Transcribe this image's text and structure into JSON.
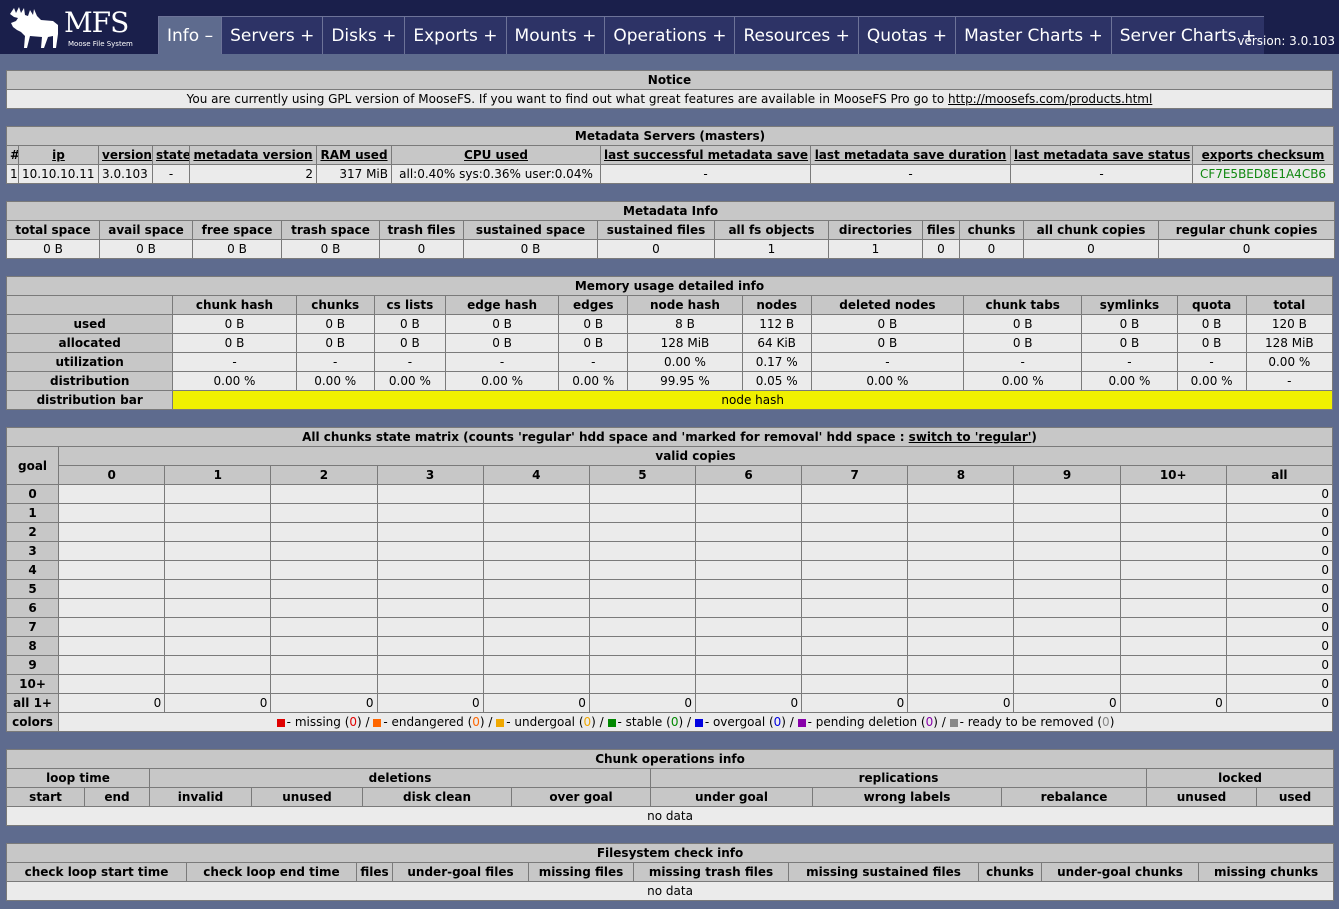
{
  "header": {
    "logo_text": "MFS",
    "logo_sub": "Moose File System",
    "tabs": [
      {
        "label": "Info –",
        "active": true
      },
      {
        "label": "Servers +"
      },
      {
        "label": "Disks +"
      },
      {
        "label": "Exports +"
      },
      {
        "label": "Mounts +"
      },
      {
        "label": "Operations +"
      },
      {
        "label": "Resources +"
      },
      {
        "label": "Quotas +"
      },
      {
        "label": "Master Charts +"
      },
      {
        "label": "Server Charts +"
      }
    ],
    "version": "version: 3.0.103"
  },
  "notice": {
    "title": "Notice",
    "text": "You are currently using GPL version of MooseFS. If you want to find out what great features are available in MooseFS Pro go to ",
    "link": "http://moosefs.com/products.html"
  },
  "masters": {
    "title": "Metadata Servers (masters)",
    "cols": [
      "#",
      "ip",
      "version",
      "state",
      "metadata version",
      "RAM used",
      "CPU used",
      "last successful metadata save",
      "last metadata save duration",
      "last metadata save status",
      "exports checksum"
    ],
    "row": [
      "1",
      "10.10.10.11",
      "3.0.103",
      "-",
      "2",
      "317 MiB",
      "all:0.40% sys:0.36% user:0.04%",
      "-",
      "-",
      "-",
      "CF7E5BED8E1A4CB6"
    ]
  },
  "metainfo": {
    "title": "Metadata Info",
    "cols": [
      "total space",
      "avail space",
      "free space",
      "trash space",
      "trash files",
      "sustained space",
      "sustained files",
      "all fs objects",
      "directories",
      "files",
      "chunks",
      "all chunk copies",
      "regular chunk copies"
    ],
    "row": [
      "0 B",
      "0 B",
      "0 B",
      "0 B",
      "0",
      "0 B",
      "0",
      "1",
      "1",
      "0",
      "0",
      "0",
      "0"
    ]
  },
  "memory": {
    "title": "Memory usage detailed info",
    "cols": [
      "chunk hash",
      "chunks",
      "cs lists",
      "edge hash",
      "edges",
      "node hash",
      "nodes",
      "deleted nodes",
      "chunk tabs",
      "symlinks",
      "quota",
      "total"
    ],
    "rows": [
      {
        "label": "used",
        "values": [
          "0 B",
          "0 B",
          "0 B",
          "0 B",
          "0 B",
          "8 B",
          "112 B",
          "0 B",
          "0 B",
          "0 B",
          "0 B",
          "120 B"
        ]
      },
      {
        "label": "allocated",
        "values": [
          "0 B",
          "0 B",
          "0 B",
          "0 B",
          "0 B",
          "128 MiB",
          "64 KiB",
          "0 B",
          "0 B",
          "0 B",
          "0 B",
          "128 MiB"
        ]
      },
      {
        "label": "utilization",
        "values": [
          "-",
          "-",
          "-",
          "-",
          "-",
          "0.00 %",
          "0.17 %",
          "-",
          "-",
          "-",
          "-",
          "0.00 %"
        ]
      },
      {
        "label": "distribution",
        "values": [
          "0.00 %",
          "0.00 %",
          "0.00 %",
          "0.00 %",
          "0.00 %",
          "99.95 %",
          "0.05 %",
          "0.00 %",
          "0.00 %",
          "0.00 %",
          "0.00 %",
          "-"
        ]
      }
    ],
    "bar_label": "distribution bar",
    "bar_text": "node hash",
    "bar_color": "#f0f000"
  },
  "matrix": {
    "title_pre": "All chunks state matrix (counts 'regular' hdd space and 'marked for removal' hdd space : ",
    "title_link": "switch to 'regular'",
    "title_post": ")",
    "goal_label": "goal",
    "valid_label": "valid copies",
    "cols": [
      "0",
      "1",
      "2",
      "3",
      "4",
      "5",
      "6",
      "7",
      "8",
      "9",
      "10+",
      "all"
    ],
    "goals": [
      "0",
      "1",
      "2",
      "3",
      "4",
      "5",
      "6",
      "7",
      "8",
      "9",
      "10+"
    ],
    "all_values": [
      "0",
      "0",
      "0",
      "0",
      "0",
      "0",
      "0",
      "0",
      "0",
      "0",
      "0",
      "0"
    ],
    "all_label": "all 1+",
    "colors_label": "colors",
    "legend": [
      {
        "color": "#e00000",
        "label": "- missing (",
        "count": "0",
        "count_color": "#e00000"
      },
      {
        "color": "#ff6600",
        "label": "- endangered (",
        "count": "0",
        "count_color": "#ff6600"
      },
      {
        "color": "#f0a800",
        "label": "- undergoal (",
        "count": "0",
        "count_color": "#f0a800"
      },
      {
        "color": "#008800",
        "label": "- stable (",
        "count": "0",
        "count_color": "#008800"
      },
      {
        "color": "#0000e0",
        "label": "- overgoal (",
        "count": "0",
        "count_color": "#0000e0"
      },
      {
        "color": "#8800aa",
        "label": "- pending deletion (",
        "count": "0",
        "count_color": "#8800aa"
      },
      {
        "color": "#888888",
        "label": "- ready to be removed (",
        "count": "0",
        "count_color": "#888888"
      }
    ]
  },
  "chunkops": {
    "title": "Chunk operations info",
    "groups": [
      "loop time",
      "deletions",
      "replications",
      "locked"
    ],
    "cols": [
      "start",
      "end",
      "invalid",
      "unused",
      "disk clean",
      "over goal",
      "under goal",
      "wrong labels",
      "rebalance",
      "unused",
      "used"
    ],
    "nodata": "no data"
  },
  "fscheck": {
    "title": "Filesystem check info",
    "cols": [
      "check loop start time",
      "check loop end time",
      "files",
      "under-goal files",
      "missing files",
      "missing trash files",
      "missing sustained files",
      "chunks",
      "under-goal chunks",
      "missing chunks"
    ],
    "nodata": "no data"
  }
}
